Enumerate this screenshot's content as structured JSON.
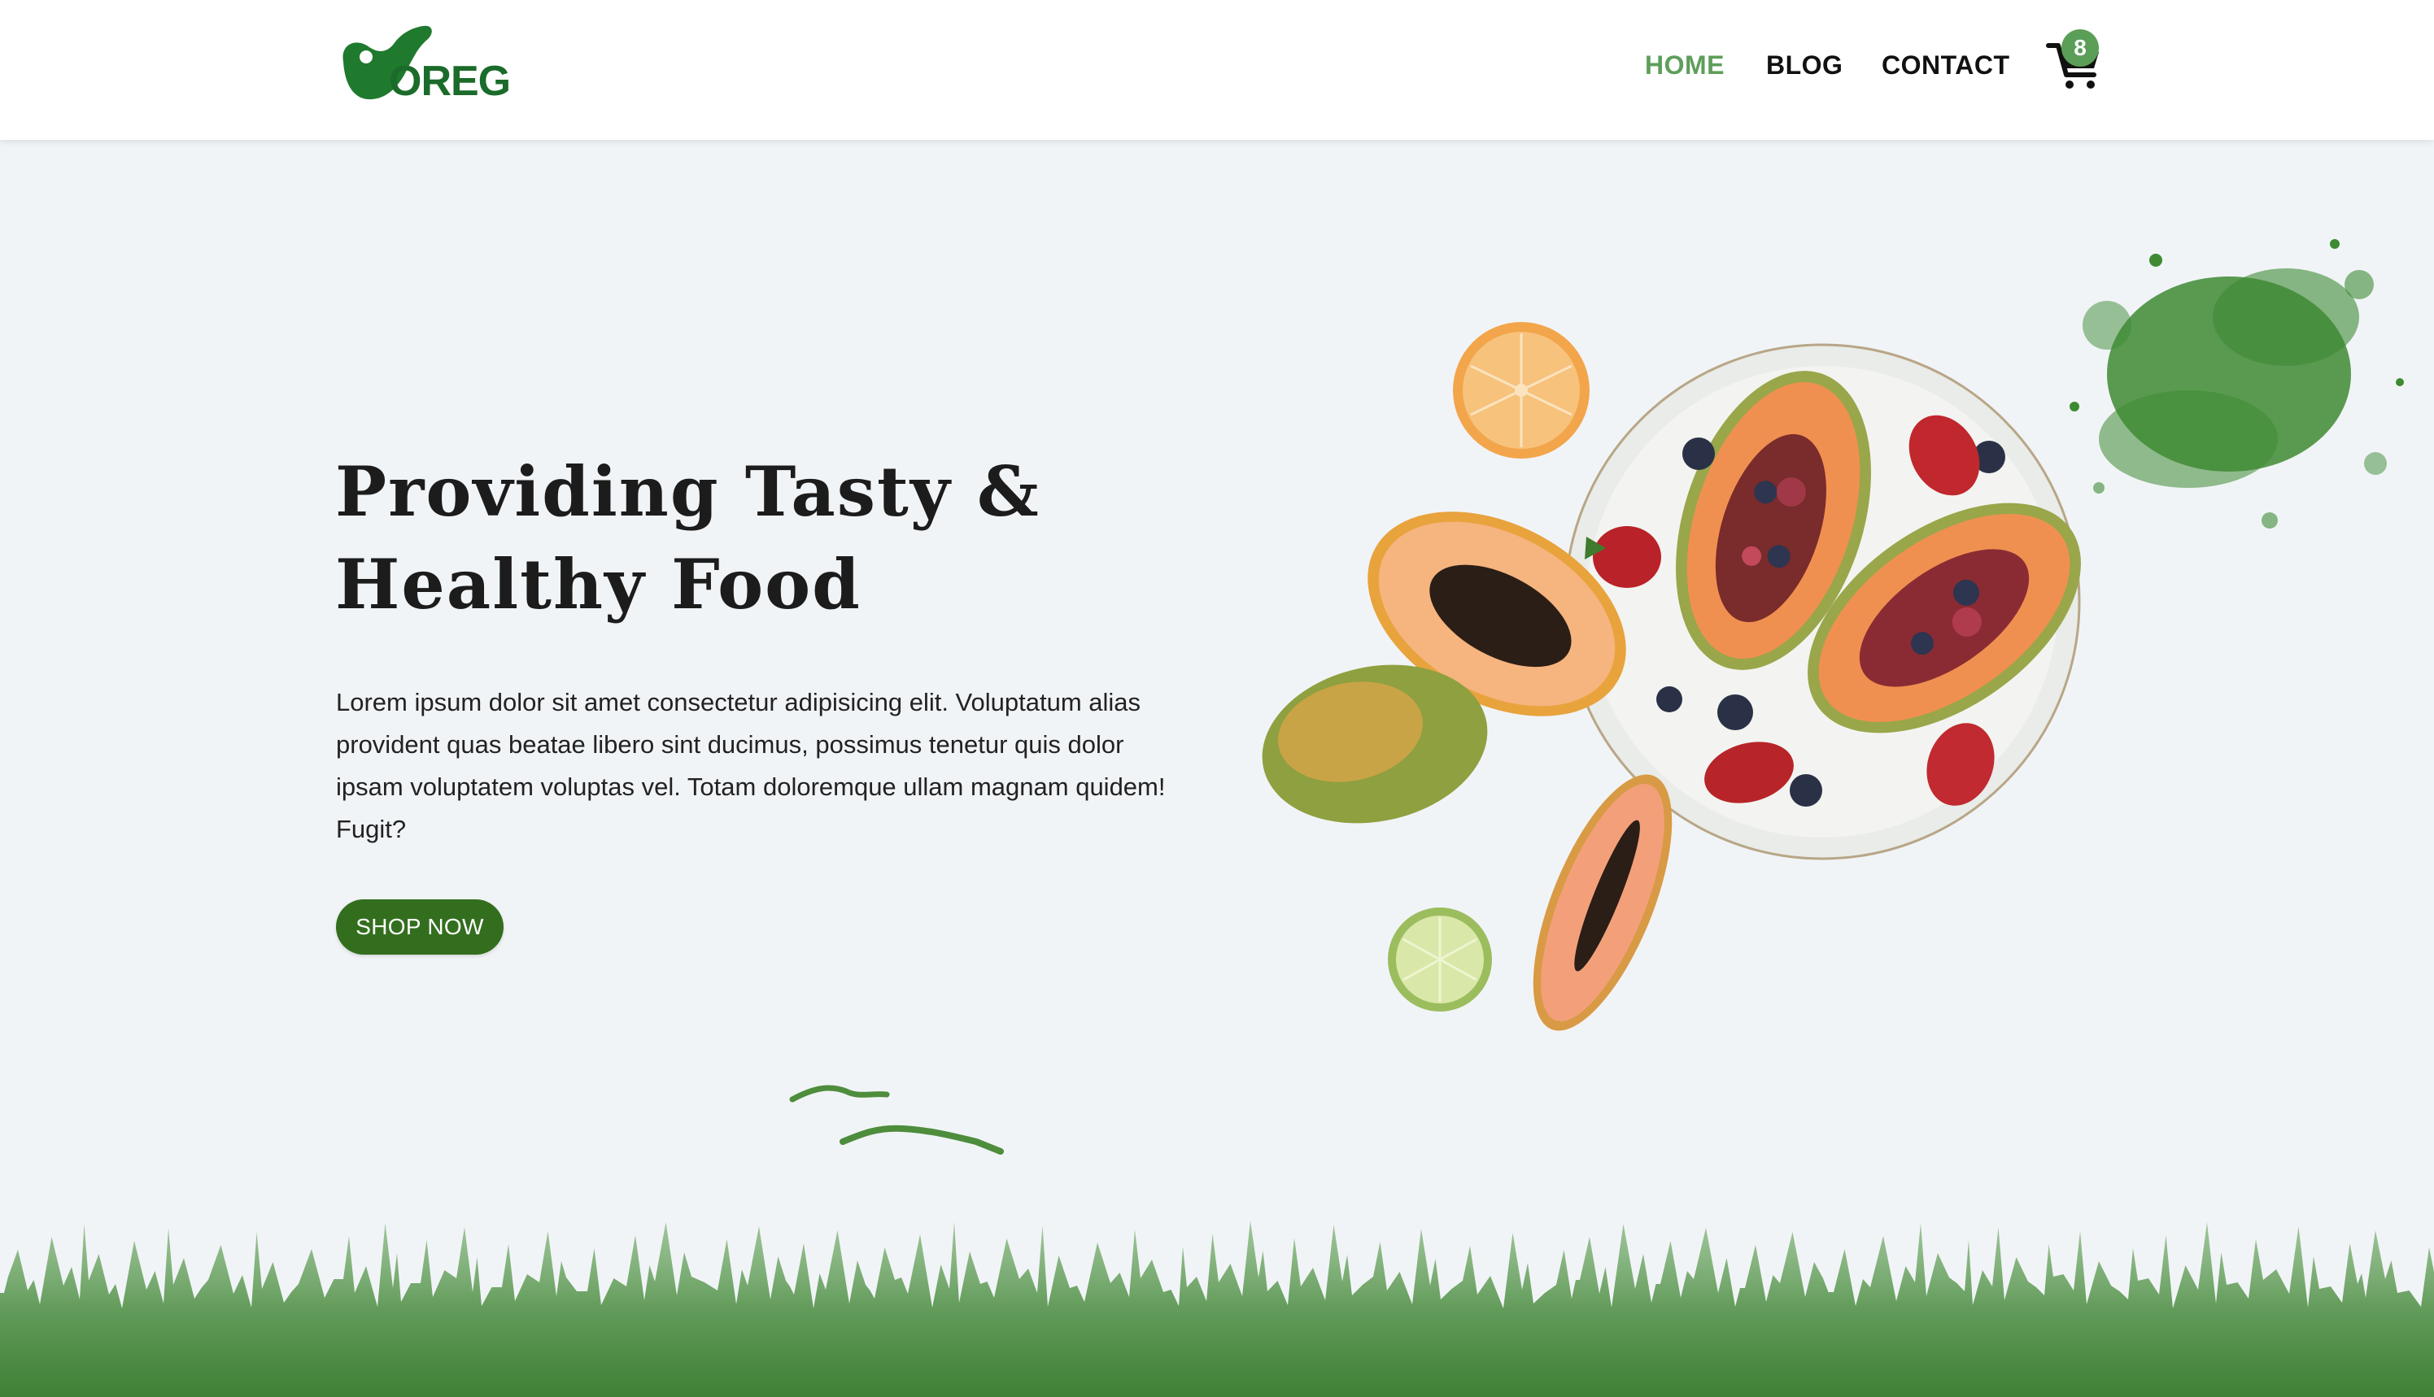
{
  "header": {
    "logo_text": "OREG",
    "nav": [
      {
        "label": "HOME",
        "active": true
      },
      {
        "label": "BLOG",
        "active": false
      },
      {
        "label": "CONTACT",
        "active": false
      }
    ],
    "cart": {
      "icon": "cart-icon",
      "count": "8"
    }
  },
  "hero": {
    "title_line1": "Providing Tasty &",
    "title_line2": "Healthy Food",
    "description": "Lorem ipsum dolor sit amet consectetur adipisicing elit. Voluptatum alias provident quas beatae libero sint ducimus, possimus tenetur quis dolor ipsam voluptatem voluptas vel. Totam doloremque ullam magnam quidem! Fugit?",
    "cta_label": "SHOP NOW",
    "image": "papaya-fruit-plate"
  },
  "colors": {
    "brand_green": "#1b6b2a",
    "nav_active": "#5e9e5a",
    "button": "#336e1e",
    "badge": "#5a9e57",
    "background": "#f1f4f7"
  }
}
